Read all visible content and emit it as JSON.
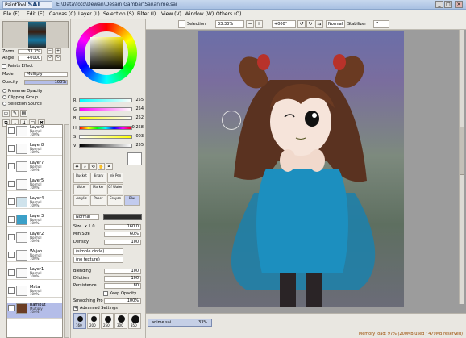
{
  "app": {
    "logo": "SAI",
    "logo_prefix": "PaintTool",
    "title": "E:\\Data\\foto\\Dewan\\Desain Gambar\\Sai\\anime.sai",
    "min": "_",
    "max": "□",
    "close": "×"
  },
  "menu": [
    "File (F)",
    "Edit (E)",
    "Canvas (C)",
    "Layer (L)",
    "Selection (S)",
    "Filter (I)",
    "View (V)",
    "Window (W)",
    "Others (O)"
  ],
  "toolbar": {
    "selection_label": "Selection",
    "zoom": "33.33%",
    "rotate": "+000°",
    "mode": "Normal",
    "stabilizer_label": "Stabilizer",
    "stabilizer_value": "7"
  },
  "navigator": {
    "zoom_label": "Zoom",
    "zoom_value": "33.3%",
    "angle_label": "Angle",
    "angle_value": "+0000"
  },
  "layer_props": {
    "paints_effect": "Paints Effect",
    "mode_label": "Mode",
    "mode_value": "Multiply",
    "opacity_label": "Opacity",
    "opacity_value": "100%",
    "preserve_opacity": "Preserve Opacity",
    "clipping_group": "Clipping Group",
    "selection_source": "Selection Source"
  },
  "layers": [
    {
      "name": "Layer9",
      "mode": "Normal",
      "opacity": "100%"
    },
    {
      "name": "Layer8",
      "mode": "Normal",
      "opacity": "100%"
    },
    {
      "name": "Layer7",
      "mode": "Normal",
      "opacity": "100%"
    },
    {
      "name": "Layer5",
      "mode": "Normal",
      "opacity": "100%"
    },
    {
      "name": "Layer4",
      "mode": "Normal",
      "opacity": "100%"
    },
    {
      "name": "Layer3",
      "mode": "Normal",
      "opacity": "100%"
    },
    {
      "name": "Layer2",
      "mode": "Normal",
      "opacity": "100%"
    },
    {
      "name": "Wajah",
      "mode": "Normal",
      "opacity": "100%"
    },
    {
      "name": "Layer1",
      "mode": "Normal",
      "opacity": "100%"
    },
    {
      "name": "Mata",
      "mode": "Normal",
      "opacity": "100%"
    },
    {
      "name": "Rambut",
      "mode": "Multiply",
      "opacity": "100%"
    }
  ],
  "color": {
    "r_label": "R",
    "r_value": "255",
    "g_label": "G",
    "g_value": "254",
    "b_label": "B",
    "b_value": "252",
    "h_label": "H",
    "h_value": "0.258",
    "s_label": "S",
    "s_value": "003",
    "v_label": "V",
    "v_value": "255"
  },
  "brushes": [
    "Bucket",
    "Binary",
    "Ink Pen",
    "Water",
    "Marker",
    "Of Water",
    "Acrylic",
    "Paper",
    "Crayon",
    "Blur"
  ],
  "brush_props": {
    "mode": "Normal",
    "size_label": "Size",
    "size_mult": "x 1.0",
    "size_value": "160.0",
    "min_size_label": "Min Size",
    "min_size_value": "60%",
    "density_label": "Density",
    "density_value": "100",
    "shape": "(simple circle)",
    "texture": "(no texture)",
    "blending_label": "Blending",
    "blending_value": "100",
    "dilution_label": "Dilution",
    "dilution_value": "100",
    "persistence_label": "Persistence",
    "persistence_value": "80",
    "keep_opacity": "Keep Opacity",
    "smoothing_label": "Smoothing Pro",
    "smoothing_value": "100%",
    "advanced": "Advanced Settings",
    "sizes": [
      "160",
      "200",
      "250",
      "300",
      "350"
    ]
  },
  "status": {
    "tab_name": "anime.sai",
    "tab_zoom": "33%",
    "memory": "Memory load: 97% (200MB used / 479MB reserved)"
  },
  "colors": {
    "accent": "#b4bde8",
    "panel": "#e9e7e1",
    "memory_text": "#9a4b00"
  }
}
